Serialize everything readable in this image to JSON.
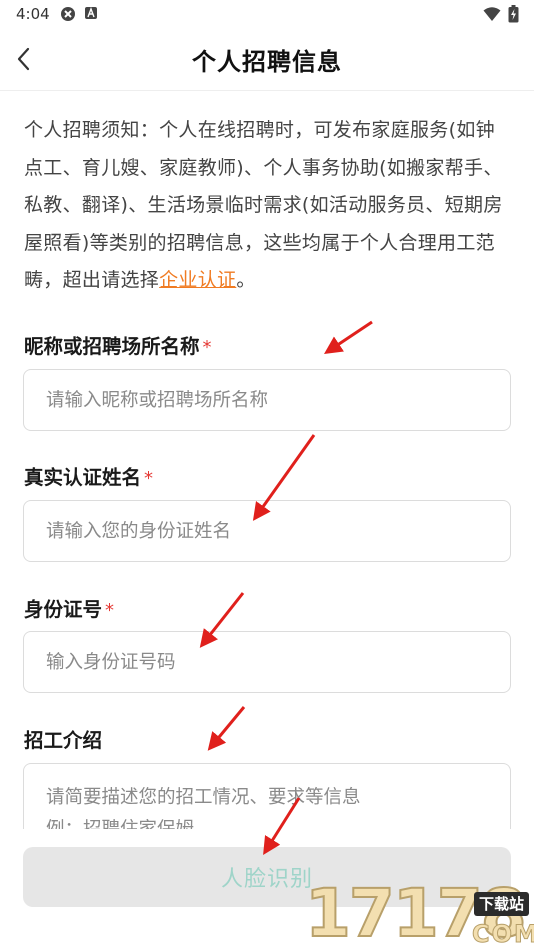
{
  "status_bar": {
    "time": "4:04",
    "icons": [
      "vpn-icon",
      "app-a-icon",
      "wifi-icon",
      "battery-icon"
    ]
  },
  "nav": {
    "title": "个人招聘信息",
    "back_icon": "chevron-left-icon"
  },
  "notice": {
    "text": "个人招聘须知：个人在线招聘时，可发布家庭服务(如钟点工、育儿嫂、家庭教师)、个人事务协助(如搬家帮手、私教、翻译)、生活场景临时需求(如活动服务员、短期房屋照看)等类别的招聘信息，这些均属于个人合理用工范畴，超出请选择",
    "link_text": "企业认证",
    "end": "。",
    "link_color": "#f07b22"
  },
  "form": {
    "nickname": {
      "label": "昵称或招聘场所名称",
      "required_mark": "*",
      "placeholder": "请输入昵称或招聘场所名称",
      "value": ""
    },
    "real_name": {
      "label": "真实认证姓名",
      "required_mark": "*",
      "placeholder": "请输入您的身份证姓名",
      "value": ""
    },
    "id_number": {
      "label": "身份证号",
      "required_mark": "*",
      "placeholder": "输入身份证号码",
      "value": ""
    },
    "intro": {
      "label": "招工介绍",
      "placeholder_line1": "请简要描述您的招工情况、要求等信息",
      "placeholder_line2": "例：招聘住家保姆"
    }
  },
  "submit": {
    "label": "人脸识别",
    "text_color": "#9fd4c9",
    "bg_color": "#e6e6e6"
  },
  "annotation": {
    "arrow_color": "#e0201c"
  },
  "watermark": {
    "digits": "17178",
    "tag": "下载站",
    "domain": "COM"
  }
}
